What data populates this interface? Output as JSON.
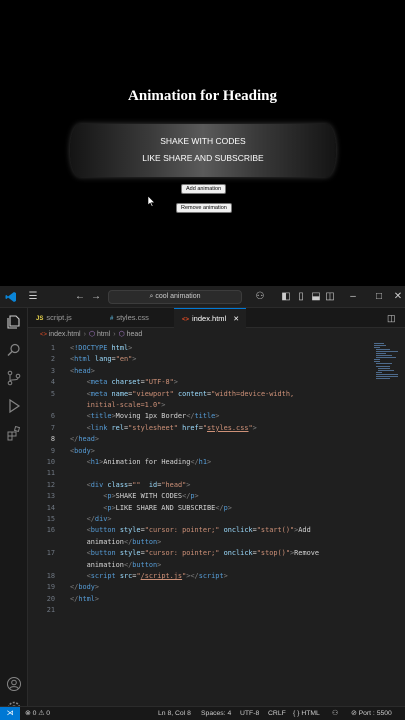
{
  "preview": {
    "heading": "Animation for Heading",
    "line1": "SHAKE WITH CODES",
    "line2": "LIKE SHARE AND SUBSCRIBE",
    "add_button": "Add animation",
    "remove_button": "Remove animation"
  },
  "titlebar": {
    "search_text": "cool animation"
  },
  "tabs": [
    {
      "label": "script.js",
      "icon": "JS"
    },
    {
      "label": "styles.css",
      "icon": "#"
    },
    {
      "label": "index.html",
      "icon": "<>",
      "close": "✕"
    }
  ],
  "breadcrumb": [
    "index.html",
    "html",
    "head"
  ],
  "editor": {
    "line_numbers": [
      "1",
      "2",
      "3",
      "4",
      "5",
      "",
      "6",
      "7",
      "8",
      "9",
      "10",
      "11",
      "12",
      "13",
      "14",
      "15",
      "16",
      "",
      "17",
      "",
      "18",
      "19",
      "20",
      "21"
    ]
  },
  "statusbar": {
    "problems": "⊗ 0 ⚠ 0",
    "position": "Ln 8, Col 8",
    "spaces": "Spaces: 4",
    "encoding": "UTF-8",
    "eol": "CRLF",
    "language": "{ } HTML",
    "port": "⊘ Port : 5500"
  },
  "colors": {
    "accent": "#0078d4",
    "tag": "#569cd6",
    "attribute": "#9cdcfe",
    "string": "#ce9178"
  }
}
